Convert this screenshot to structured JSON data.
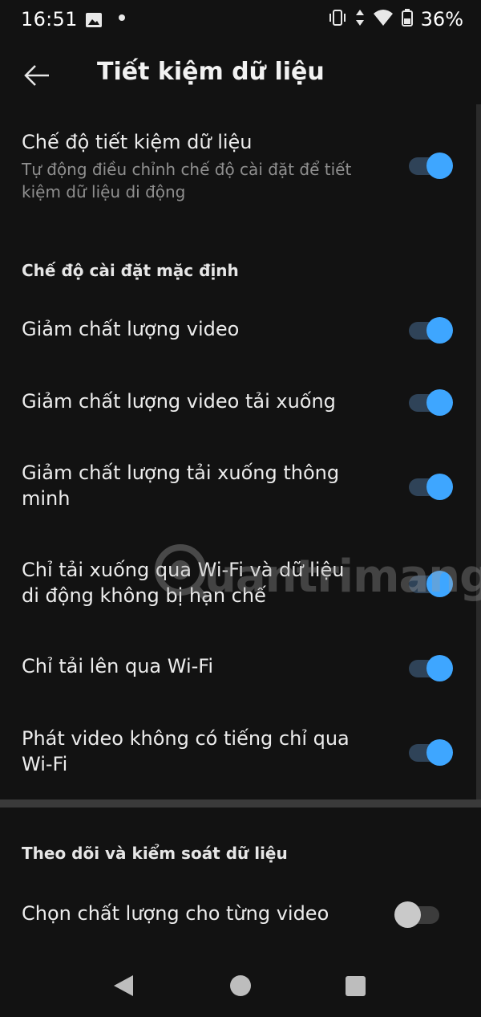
{
  "status_bar": {
    "time": "16:51",
    "battery_percent": "36%",
    "icons": [
      "gallery-icon",
      "dot-icon",
      "vibrate-icon",
      "data-arrows-icon",
      "wifi-icon",
      "battery-icon"
    ]
  },
  "app_bar": {
    "title": "Tiết kiệm dữ liệu",
    "back_icon": "arrow-left-icon"
  },
  "main_setting": {
    "title": "Chế độ tiết kiệm dữ liệu",
    "subtitle": "Tự động điều chỉnh chế độ cài đặt để tiết kiệm dữ liệu di động",
    "enabled": true
  },
  "section_default": {
    "header": "Chế độ cài đặt mặc định",
    "items": [
      {
        "label": "Giảm chất lượng video",
        "enabled": true
      },
      {
        "label": "Giảm chất lượng video tải xuống",
        "enabled": true
      },
      {
        "label": "Giảm chất lượng tải xuống thông minh",
        "enabled": true
      },
      {
        "label": "Chỉ tải xuống qua Wi-Fi và dữ liệu di động không bị hạn chế",
        "enabled": true
      },
      {
        "label": "Chỉ tải lên qua Wi-Fi",
        "enabled": true
      },
      {
        "label": "Phát video không có tiếng chỉ qua Wi-Fi",
        "enabled": true
      }
    ]
  },
  "section_monitor": {
    "header": "Theo dõi và kiểm soát dữ liệu",
    "items": [
      {
        "label": "Chọn chất lượng cho từng video",
        "enabled": false
      }
    ]
  },
  "watermark": {
    "text": "uantrimang"
  },
  "colors": {
    "background": "#121212",
    "accent": "#3ea6ff",
    "track_on": "#2f4358",
    "text_secondary": "#8f8f8f"
  },
  "nav_bar": {
    "icons": [
      "nav-back-triangle-icon",
      "nav-home-circle-icon",
      "nav-recent-square-icon"
    ]
  }
}
